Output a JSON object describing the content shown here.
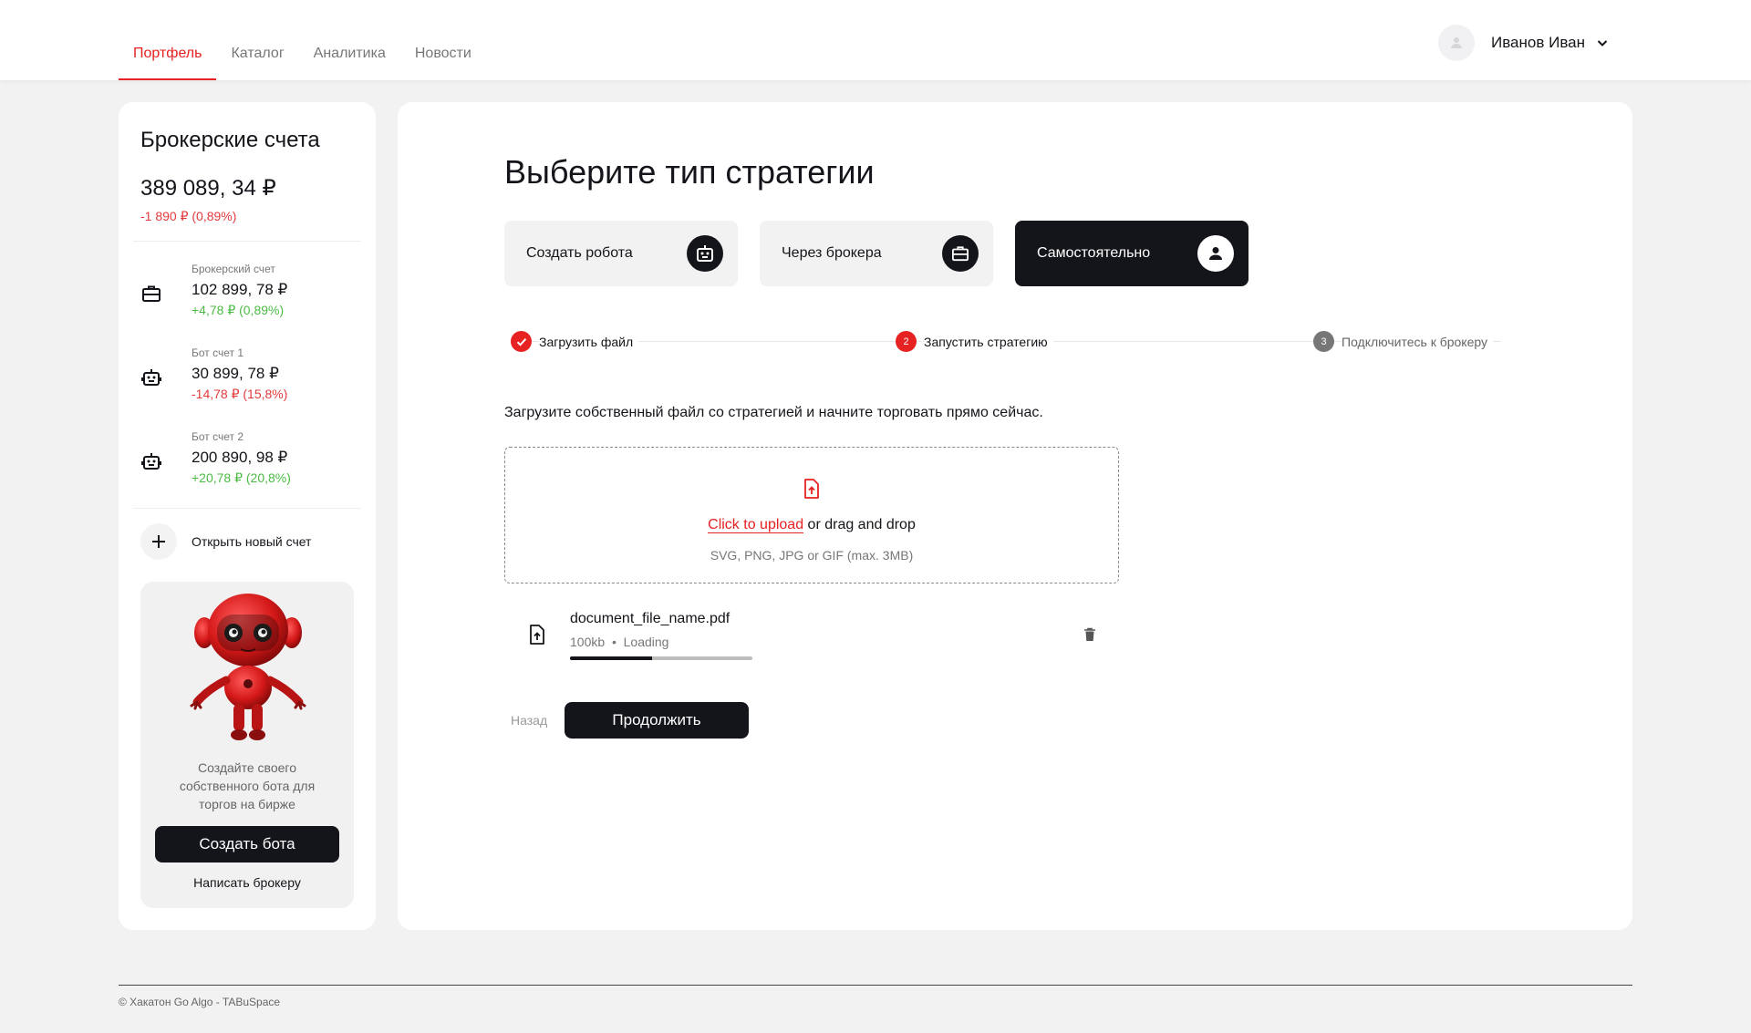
{
  "nav": {
    "items": [
      {
        "label": "Портфель",
        "active": true
      },
      {
        "label": "Каталог",
        "active": false
      },
      {
        "label": "Аналитика",
        "active": false
      },
      {
        "label": "Новости",
        "active": false
      }
    ]
  },
  "user": {
    "name": "Иванов Иван"
  },
  "sidebar": {
    "title": "Брокерские счета",
    "total": "389 089, 34 ₽",
    "total_change": "-1 890 ₽ (0,89%)",
    "accounts": [
      {
        "label": "Брокерский счет",
        "value": "102 899, 78 ₽",
        "change": "+4,78 ₽ (0,89%)",
        "trend": "up",
        "icon": "briefcase-icon"
      },
      {
        "label": "Бот счет 1",
        "value": "30 899, 78 ₽",
        "change": "-14,78 ₽ (15,8%)",
        "trend": "down",
        "icon": "robot-icon"
      },
      {
        "label": "Бот счет 2",
        "value": "200 890, 98 ₽",
        "change": "+20,78 ₽ (20,8%)",
        "trend": "up",
        "icon": "robot-icon"
      }
    ],
    "new_account": "Открыть новый счет",
    "promo": {
      "text": "Создайте своего собственного бота для торгов на бирже",
      "button": "Создать бота",
      "link": "Написать брокеру"
    }
  },
  "main": {
    "title": "Выберите тип стратегии",
    "options": [
      {
        "label": "Создать робота",
        "icon": "robot-icon",
        "selected": false
      },
      {
        "label": "Через брокера",
        "icon": "briefcase-icon",
        "selected": false
      },
      {
        "label": "Самостоятельно",
        "icon": "person-icon",
        "selected": true
      }
    ],
    "steps": [
      {
        "number": "1",
        "label": "Загрузить файл",
        "status": "done"
      },
      {
        "number": "2",
        "label": "Запустить стратегию",
        "status": "current"
      },
      {
        "number": "3",
        "label": "Подключитесь к брокеру",
        "status": "todo"
      }
    ],
    "description": "Загрузите собственный файл со стратегией и начните торговать прямо сейчас.",
    "upload": {
      "link": "Click to upload",
      "rest": " or drag and drop",
      "hint": "SVG, PNG, JPG or GIF (max. 3MB)"
    },
    "file": {
      "name": "document_file_name.pdf",
      "size": "100kb",
      "separator": "•",
      "status": "Loading",
      "progress": 0.45
    },
    "back": "Назад",
    "continue": "Продолжить"
  },
  "footer": {
    "text": "© Хакатон Go Algo - TABuSpace"
  },
  "colors": {
    "accent": "#e62222",
    "dark": "#14151a",
    "positive": "#4cbb45",
    "negative": "#e23b3b"
  }
}
